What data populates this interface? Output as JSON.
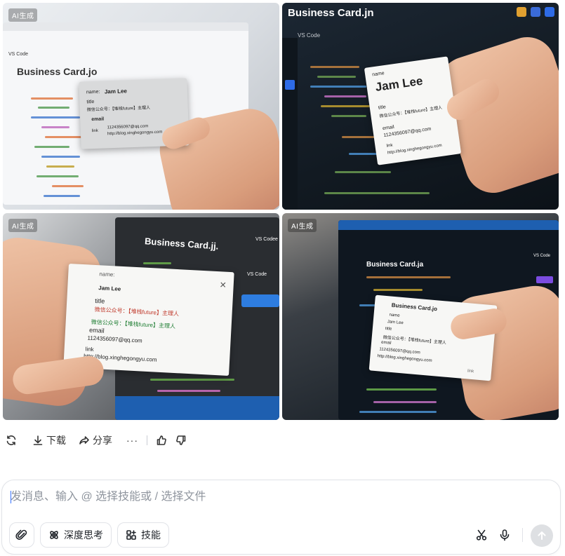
{
  "images": [
    {
      "badge": "AI生成",
      "editor_title": "Business Card.jo",
      "menu_text": "VS Code",
      "card": {
        "name_label": "name:",
        "name_value": "Jam Lee",
        "title_label": "title",
        "title_value": "微信公众号：【堆栈future】主理人",
        "email_label": "email",
        "email_value": "1124356097@qq.com",
        "link_label": "link",
        "link_value": "http://blog.xinghegongyu.com"
      }
    },
    {
      "badge": "",
      "editor_title": "Business Card.jn",
      "menu_text": "VS Code",
      "card": {
        "name_label": "name",
        "name_value": "Jam Lee",
        "title_label": "title",
        "title_value": "微信公众号：【堆栈future】主理人",
        "email_label": "email",
        "email_value": "1124356097@qq.com",
        "link_label": "link",
        "link_value": "http://blog.xinghegongyu.com"
      }
    },
    {
      "badge": "AI生成",
      "editor_title": "Business Card.jj.",
      "menu_text": "VS Codee",
      "side_text": "VS Code",
      "card": {
        "name_label": "name:",
        "name_value": "Jam Lee",
        "title_label": "title",
        "title_value": "微信公众号：【堆栈future】主理人",
        "title_value2": "微信公众号：【堆栈future】主理人",
        "email_label": "email",
        "email_value": "1124356097@qq.com",
        "link_label": "link",
        "link_value": "http://blog.xinghegongyu.com"
      }
    },
    {
      "badge": "AI生成",
      "editor_title": "Business Card.ja",
      "side_text": "VS Code",
      "card": {
        "heading": "Business Card.jo",
        "name_label": "name",
        "name_value": "Jam Lee",
        "title_label": "title",
        "title_value": "微信公众号：【堆栈future】主理人",
        "email_label": "email",
        "email_value": "1124356097@qq.com",
        "link_value": "http://blog.xinghegongyu.com",
        "link_label": "link"
      }
    }
  ],
  "actions": {
    "regenerate_icon": "refresh-icon",
    "download_label": "下载",
    "share_label": "分享",
    "more_label": "···"
  },
  "composer": {
    "placeholder": "发消息、输入 @ 选择技能或 / 选择文件",
    "deep_think_label": "深度思考",
    "skills_label": "技能"
  },
  "colors": {
    "accent": "#3370ff",
    "send_disabled": "#dee0e3",
    "border": "#e1e3e8"
  }
}
